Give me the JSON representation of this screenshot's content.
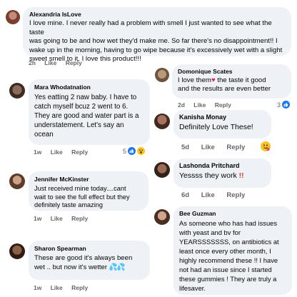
{
  "comments": [
    {
      "name": "Alexandria IsLove",
      "text": "I love mine. I never really had a problem with smell I just wanted to see what the taste\nwas going to be and how wet they'd make me. So far there's no disappointment!! I\nwake up in the morning, having to go wipe because it's excessively wet with a slight\nsweet smell to it. I love this product!!!",
      "time": "2h",
      "like": "Like",
      "reply": "Reply"
    },
    {
      "name": "Domonique Scates",
      "text_before": "I love them",
      "text_heart": "♥",
      "text_after": " the taste it good\nand the results are even better",
      "time": "2d",
      "like": "Like",
      "reply": "Reply",
      "reaction_count": "3"
    },
    {
      "name": "Mara Whodatnation",
      "text": "Yes eatting 2 naw baby. I have to\ncatch myself bcuz 2 went to 6.\nThey are good and water part is a\nunderstatement. Let's say an\nocean",
      "time": "1w",
      "like": "Like",
      "reply": "Reply",
      "reaction_count": "5"
    },
    {
      "name": "Kanisha Monay",
      "text": "Definitely Love These!",
      "time": "5d",
      "like": "Like",
      "reply": "Reply"
    },
    {
      "name": "Jennifer McKinster",
      "text": "Just received mine today....cant\nwait to see the full effect but they\ndefinitely taste amazing",
      "time": "1w",
      "like": "Like",
      "reply": "Reply"
    },
    {
      "name": "Lashonda Pritchard",
      "text": "Yessss they work",
      "text_bang": "!!",
      "time": "6d",
      "like": "Like",
      "reply": "Reply"
    },
    {
      "name": "Bee Guzman",
      "text": "As someone who has had issues\nwith yeast and bv for\nYEARSSSSSSS, on antibiotics at\nleast once every other month, I\nhighly recommend these !! I have\nnot had an issue since I started\nthese gummies ! They are truly a\nlifesaver.",
      "time": "",
      "like": "",
      "reply": ""
    },
    {
      "name": "Sharon Spearman",
      "text": "These are good it's always been\nwet .. but now it's wetter",
      "text_drops": "💦💦",
      "time": "1w",
      "like": "Like",
      "reply": "Reply"
    }
  ],
  "colors": {
    "bubble": "#eef2f7",
    "meta": "#65676b",
    "like_blue": "#1877f2"
  },
  "icons": [
    "like-reaction-icon",
    "heart-reaction-icon",
    "wow-reaction-icon",
    "hug-reaction-icon"
  ]
}
